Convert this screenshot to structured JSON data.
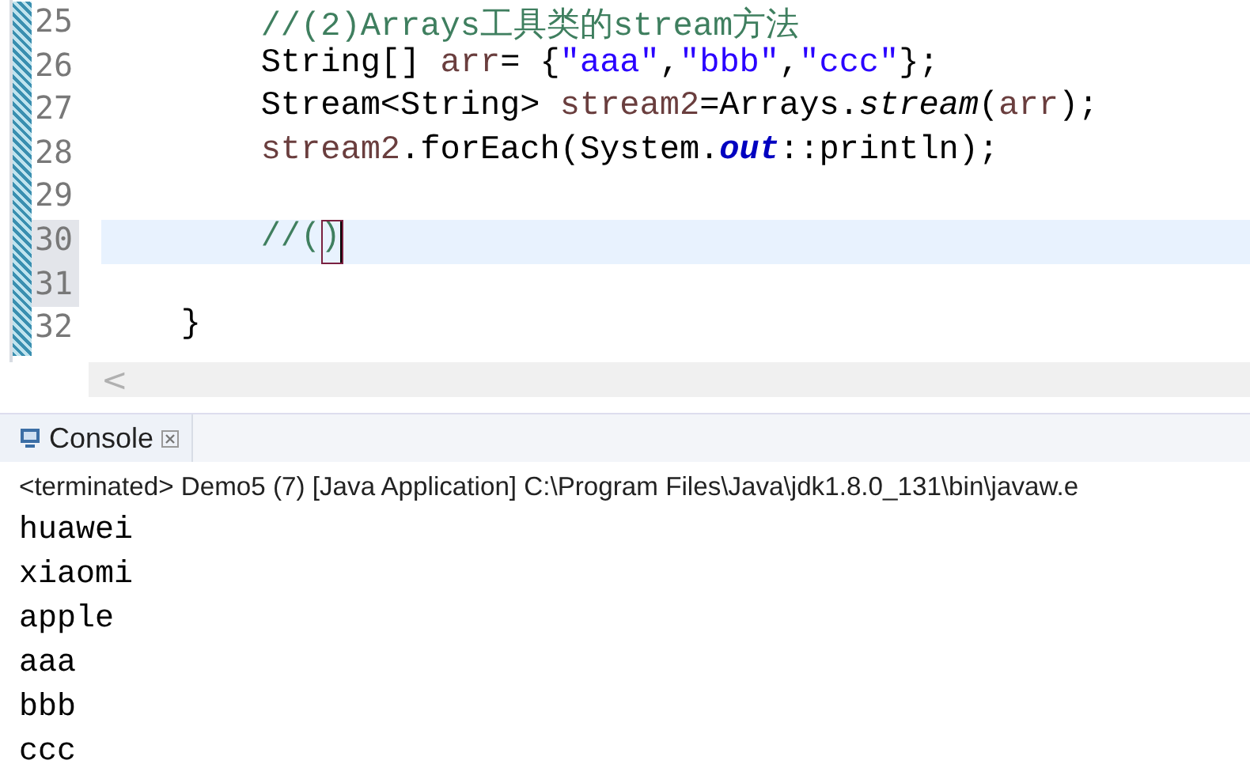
{
  "editor": {
    "lines": [
      {
        "number": "25",
        "current": false,
        "marked": false,
        "tokens": [
          {
            "kind": "comment",
            "text": "        //(2)Arrays工具类的stream方法"
          }
        ]
      },
      {
        "number": "26",
        "current": false,
        "marked": false,
        "tokens": [
          {
            "kind": "plain",
            "text": "        String[] "
          },
          {
            "kind": "variable",
            "text": "arr"
          },
          {
            "kind": "plain",
            "text": "= {"
          },
          {
            "kind": "string",
            "text": "\"aaa\""
          },
          {
            "kind": "plain",
            "text": ","
          },
          {
            "kind": "string",
            "text": "\"bbb\""
          },
          {
            "kind": "plain",
            "text": ","
          },
          {
            "kind": "string",
            "text": "\"ccc\""
          },
          {
            "kind": "plain",
            "text": "};"
          }
        ]
      },
      {
        "number": "27",
        "current": false,
        "marked": false,
        "tokens": [
          {
            "kind": "plain",
            "text": "        Stream<String> "
          },
          {
            "kind": "variable",
            "text": "stream2"
          },
          {
            "kind": "plain",
            "text": "=Arrays."
          },
          {
            "kind": "static",
            "text": "stream"
          },
          {
            "kind": "plain",
            "text": "("
          },
          {
            "kind": "variable",
            "text": "arr"
          },
          {
            "kind": "plain",
            "text": ");"
          }
        ]
      },
      {
        "number": "28",
        "current": false,
        "marked": false,
        "tokens": [
          {
            "kind": "variable",
            "text": "        stream2"
          },
          {
            "kind": "plain",
            "text": ".forEach(System."
          },
          {
            "kind": "field",
            "text": "out"
          },
          {
            "kind": "plain",
            "text": "::println);"
          }
        ]
      },
      {
        "number": "29",
        "current": false,
        "marked": false
      },
      {
        "number": "30",
        "current": true,
        "marked": true,
        "tokens": [
          {
            "kind": "comment",
            "text": "        //("
          },
          {
            "kind": "bracket",
            "text": ")"
          }
        ]
      },
      {
        "number": "31",
        "current": false,
        "marked": true
      },
      {
        "number": "32",
        "current": false,
        "marked": false,
        "tokens": [
          {
            "kind": "plain",
            "text": "    }"
          }
        ]
      }
    ],
    "scroll_left": "<"
  },
  "console": {
    "tab": {
      "label": "Console",
      "selected": true
    },
    "header": "<terminated> Demo5 (7) [Java Application] C:\\Program Files\\Java\\jdk1.8.0_131\\bin\\javaw.e",
    "output": [
      "huawei",
      "xiaomi",
      "apple",
      "aaa",
      "bbb",
      "ccc"
    ]
  }
}
